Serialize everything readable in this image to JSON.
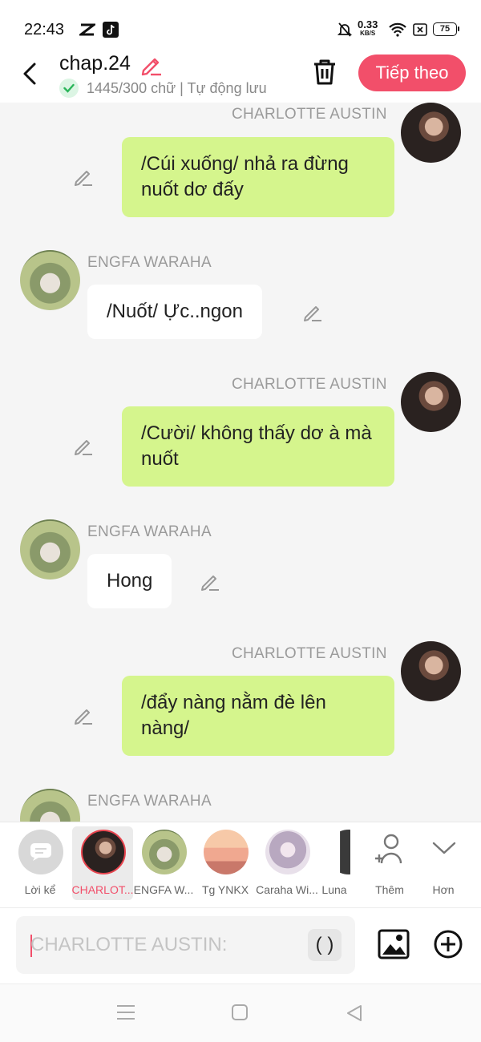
{
  "status_bar": {
    "time": "22:43",
    "net_speed_value": "0.33",
    "net_speed_unit": "KB/S",
    "battery": "75",
    "icons": [
      "capcut-icon",
      "tiktok-icon",
      "mute-icon",
      "wifi-icon",
      "close-box-icon",
      "battery-icon"
    ]
  },
  "header": {
    "title": "chap.24",
    "save_status": "1445/300 chữ | Tự động lưu",
    "next_label": "Tiếp theo",
    "accent_color": "#f24f6a"
  },
  "messages": [
    {
      "sender": "CHARLOTTE AUSTIN",
      "text": "/Cúi xuống/ nhả ra đừng nuốt dơ đấy",
      "side": "right"
    },
    {
      "sender": "ENGFA WARAHA",
      "text": "/Nuốt/ Ực..ngon",
      "side": "left"
    },
    {
      "sender": "CHARLOTTE AUSTIN",
      "text": "/Cười/ không thấy dơ à mà nuốt",
      "side": "right"
    },
    {
      "sender": "ENGFA WARAHA",
      "text": "Hong",
      "side": "left"
    },
    {
      "sender": "CHARLOTTE AUSTIN",
      "text": "/đẩy nàng nằm đè lên nàng/",
      "side": "right"
    },
    {
      "sender": "ENGFA WARAHA",
      "text": "",
      "side": "left"
    }
  ],
  "characters": {
    "narrator": "Lời kể",
    "items": [
      {
        "label": "CHARLOTTE AUSTIN",
        "short": "CHARLOT...",
        "selected": true
      },
      {
        "label": "ENGFA WARAHA",
        "short": "ENGFA W..."
      },
      {
        "label": "Tg YNKX",
        "short": "Tg YNKX"
      },
      {
        "label": "Caraha Wi...",
        "short": "Caraha Wi..."
      },
      {
        "label": "Luna",
        "short": "Luna"
      }
    ],
    "more_label": "Thêm",
    "expand_label": "Hơn"
  },
  "input": {
    "placeholder": "CHARLOTTE AUSTIN:",
    "paren_label": "( )"
  },
  "colors": {
    "bubble_right": "#d5f58d",
    "bubble_left": "#ffffff",
    "selected_ring": "#e8454f"
  }
}
